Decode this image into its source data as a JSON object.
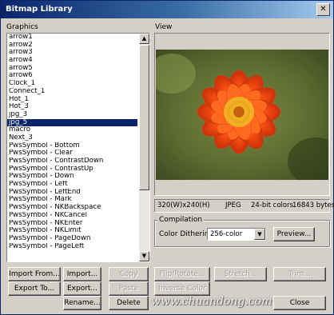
{
  "window": {
    "title": "Bitmap Library",
    "close_glyph": "✕"
  },
  "graphics": {
    "label": "Graphics",
    "items": [
      "arrow1",
      "arrow2",
      "arrow3",
      "arrow4",
      "arrow5",
      "arrow6",
      "Clock_1",
      "Connect_1",
      "Hot_1",
      "Hot_3",
      "jpg_3",
      "jpg_5",
      "macro",
      "Next_3",
      "PwsSymbol - Bottom",
      "PwsSymbol - Clear",
      "PwsSymbol - ContrastDown",
      "PwsSymbol - ContrastUp",
      "PwsSymbol - Down",
      "PwsSymbol - Left",
      "PwsSymbol - LeftEnd",
      "PwsSymbol - Mark",
      "PwsSymbol - NKBackspace",
      "PwsSymbol - NKCancel",
      "PwsSymbol - NKEnter",
      "PwsSymbol - NKLimit",
      "PwsSymbol - PageDown",
      "PwsSymbol - PageLeft"
    ],
    "selected": "jpg_5"
  },
  "view": {
    "label": "View",
    "info": {
      "size": "320(W)x240(H)",
      "format": "JPEG",
      "colors": "24-bit colors",
      "bytes": "16843 bytes"
    }
  },
  "compilation": {
    "label": "Compilation",
    "dither_label": "Color Dithering:",
    "dither_value": "256-color",
    "preview_button": "Preview..."
  },
  "buttons": {
    "import_from": "Import From...",
    "import": "Import...",
    "export_to": "Export To...",
    "export": "Export...",
    "rename": "Rename...",
    "delete": "Delete",
    "copy": "Copy",
    "paste": "Paste",
    "flip_rotate": "Flip/Rotate...",
    "inverse_color": "Inverse Color",
    "stretch": "Stretch...",
    "trim": "Trim...",
    "close": "Close"
  },
  "watermark": "www.chuandong.com",
  "colors": {
    "title_start": "#0a246a",
    "title_end": "#a6caf0",
    "selection": "#0a246a",
    "dialog_bg": "#d4d0c8",
    "view_bg": "#d4d0c8"
  }
}
